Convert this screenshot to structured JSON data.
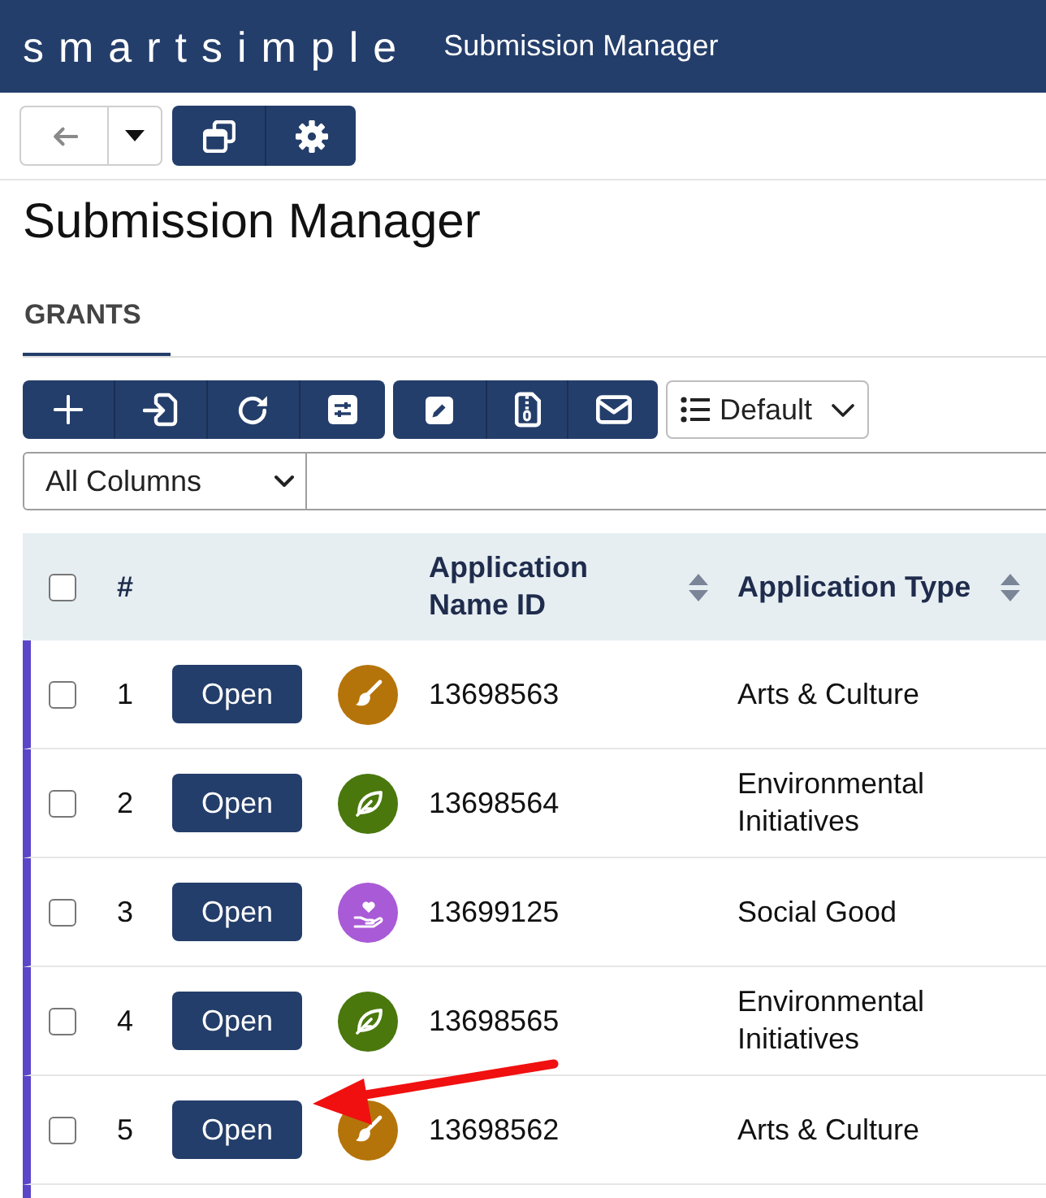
{
  "header": {
    "logo": "smartsimple",
    "title": "Submission Manager"
  },
  "page_title": "Submission Manager",
  "tabs": [
    {
      "label": "GRANTS",
      "selected": true
    }
  ],
  "toolbar": {
    "view": "Default"
  },
  "filter": {
    "column": "All Columns"
  },
  "table": {
    "select_all": {
      "checked": false
    },
    "columns": [
      {
        "label": "#",
        "sortable": false
      },
      {
        "label": "Application Name ID",
        "sortable": true
      },
      {
        "label": "Application Type",
        "sortable": true
      }
    ],
    "rows": [
      {
        "checked": false,
        "number": "1",
        "action": "Open",
        "kind": "brush",
        "color": "#b5740a",
        "id": "13698563",
        "application_type": "Arts & Culture"
      },
      {
        "checked": false,
        "number": "2",
        "action": "Open",
        "kind": "leaf",
        "color": "#4a780d",
        "id": "13698564",
        "application_type": "Environmental Initiatives"
      },
      {
        "checked": false,
        "number": "3",
        "action": "Open",
        "kind": "hand",
        "color": "#a95ad6",
        "id": "13699125",
        "application_type": "Social Good"
      },
      {
        "checked": false,
        "number": "4",
        "action": "Open",
        "kind": "leaf",
        "color": "#4a780d",
        "id": "13698565",
        "application_type": "Environmental Initiatives"
      },
      {
        "checked": false,
        "number": "5",
        "action": "Open",
        "kind": "brush",
        "color": "#b5740a",
        "id": "13698562",
        "application_type": "Arts & Culture"
      }
    ]
  },
  "annotations": [
    {
      "kind": "arrow"
    }
  ]
}
